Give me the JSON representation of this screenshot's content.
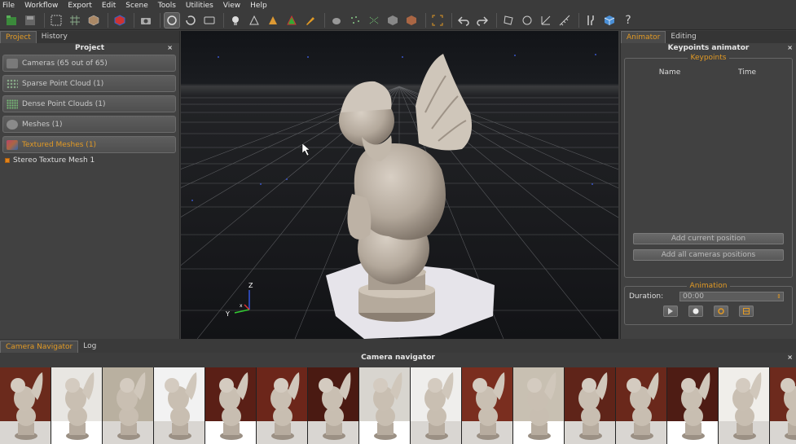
{
  "menu": [
    "File",
    "Workflow",
    "Export",
    "Edit",
    "Scene",
    "Tools",
    "Utilities",
    "View",
    "Help"
  ],
  "left_panel": {
    "tabs": [
      "Project",
      "History"
    ],
    "title": "Project",
    "close": "×",
    "items": [
      {
        "label": "Cameras (65 out of 65)",
        "icon": "camera-icon"
      },
      {
        "label": "Sparse Point Cloud (1)",
        "icon": "sparse-cloud-icon"
      },
      {
        "label": "Dense Point Clouds (1)",
        "icon": "dense-cloud-icon"
      },
      {
        "label": "Meshes (1)",
        "icon": "mesh-icon"
      },
      {
        "label": "Textured Meshes (1)",
        "icon": "textured-mesh-icon"
      }
    ],
    "tree_item": "Stereo Texture Mesh 1"
  },
  "right_panel": {
    "tabs": [
      "Animator",
      "Editing"
    ],
    "title": "Keypoints animator",
    "close": "×",
    "keypoints_label": "Keypoints",
    "col_name": "Name",
    "col_time": "Time",
    "add_current": "Add current position",
    "add_all": "Add all cameras positions",
    "animation_label": "Animation",
    "duration_label": "Duration:",
    "duration_value": "00:00"
  },
  "bottom": {
    "tabs": [
      "Camera Navigator",
      "Log"
    ],
    "title": "Camera navigator",
    "close": "×"
  },
  "axes": {
    "z": "Z",
    "y": "Y",
    "x": "x"
  },
  "colors": {
    "accent": "#e29a25",
    "panel": "#414141",
    "viewport": "#15171a"
  }
}
